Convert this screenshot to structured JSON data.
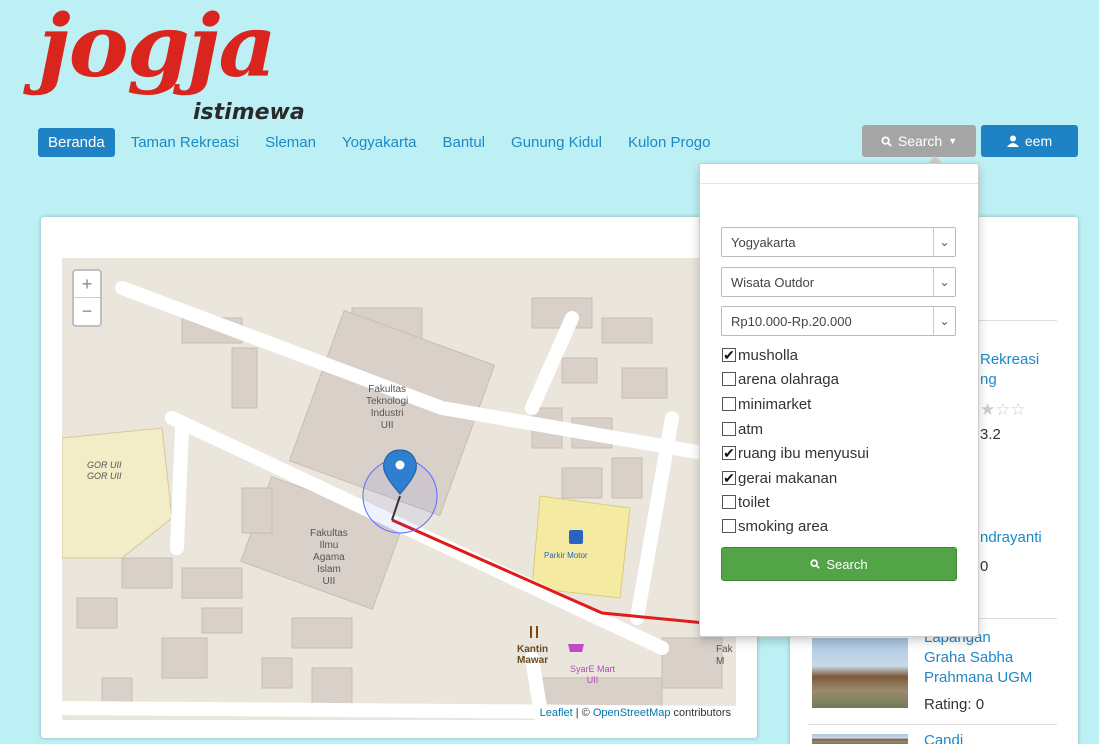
{
  "logo": {
    "main": "jogja",
    "sub": "istimewa"
  },
  "nav": {
    "items": [
      {
        "label": "Beranda",
        "active": true
      },
      {
        "label": "Taman Rekreasi",
        "active": false
      },
      {
        "label": "Sleman",
        "active": false
      },
      {
        "label": "Yogyakarta",
        "active": false
      },
      {
        "label": "Bantul",
        "active": false
      },
      {
        "label": "Gunung Kidul",
        "active": false
      },
      {
        "label": "Kulon Progo",
        "active": false
      }
    ]
  },
  "header_buttons": {
    "search_label": "Search",
    "user_label": "eem"
  },
  "search_panel": {
    "selects": [
      {
        "value": "Yogyakarta"
      },
      {
        "value": "Wisata Outdor"
      },
      {
        "value": "Rp10.000-Rp.20.000"
      }
    ],
    "facilities": [
      {
        "label": "musholla",
        "checked": true
      },
      {
        "label": "arena olahraga",
        "checked": false
      },
      {
        "label": "minimarket",
        "checked": false
      },
      {
        "label": "atm",
        "checked": false
      },
      {
        "label": "ruang ibu menyusui",
        "checked": true
      },
      {
        "label": "gerai makanan",
        "checked": true
      },
      {
        "label": "toilet",
        "checked": false
      },
      {
        "label": "smoking area",
        "checked": false
      }
    ],
    "submit_label": "Search"
  },
  "map": {
    "labels": {
      "gor": "GOR UII\nGOR UII",
      "teknologi": "Fakultas\nTeknologi\nIndustri\nUII",
      "agama": "Fakultas\nIlmu\nAgama\nIslam\nUII",
      "parkir": "Parkir Motor",
      "kantin": "Kantin\nMawar",
      "mart": "SyarE Mart\nUII",
      "fak_partial": "Fak\nM"
    },
    "attribution": {
      "leaflet": "Leaflet",
      "sep": " | © ",
      "osm": "OpenStreetMap",
      "tail": " contributors"
    }
  },
  "sidebar": {
    "items": [
      {
        "title_partial": "Rekreasi\nng",
        "rating_partial": "3.2"
      },
      {
        "title_partial": "ndrayanti",
        "rating_partial": "0"
      },
      {
        "title": "Lapangan\nGraha Sabha\nPrahmana UGM",
        "rating": "Rating: 0"
      },
      {
        "title_partial": "Candi"
      }
    ]
  },
  "colors": {
    "accent": "#1e82c4",
    "logo_red": "#d9251d",
    "search_green": "#52a447",
    "page_bg": "#bdf0f5"
  }
}
